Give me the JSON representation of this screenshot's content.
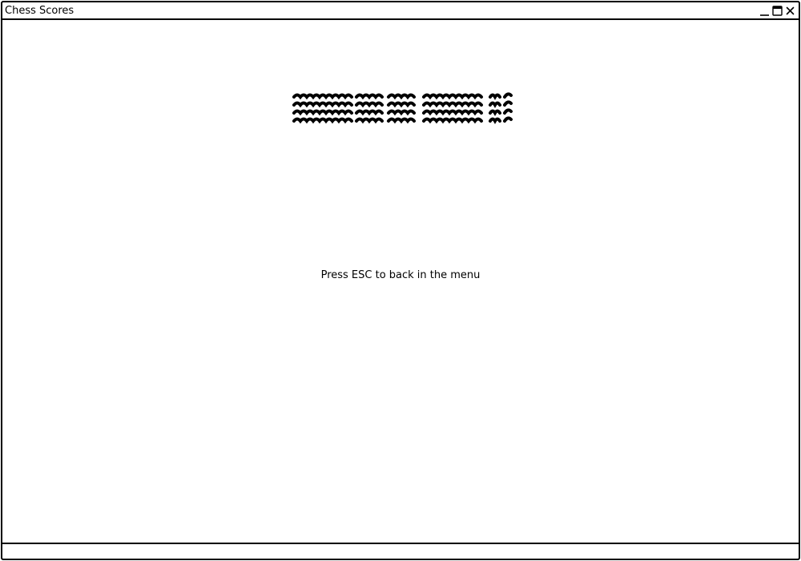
{
  "window": {
    "title": "Chess Scores",
    "controls": {
      "minimize_icon": "minimize-icon",
      "maximize_icon": "maximize-icon",
      "close_icon": "close-icon"
    }
  },
  "main": {
    "placeholder_text_block": {
      "icon": "scribble-text-placeholder",
      "lines": 4
    },
    "hint": "Press ESC to back in the menu"
  },
  "colors": {
    "border": "#000000",
    "background": "#ffffff",
    "text": "#000000"
  }
}
